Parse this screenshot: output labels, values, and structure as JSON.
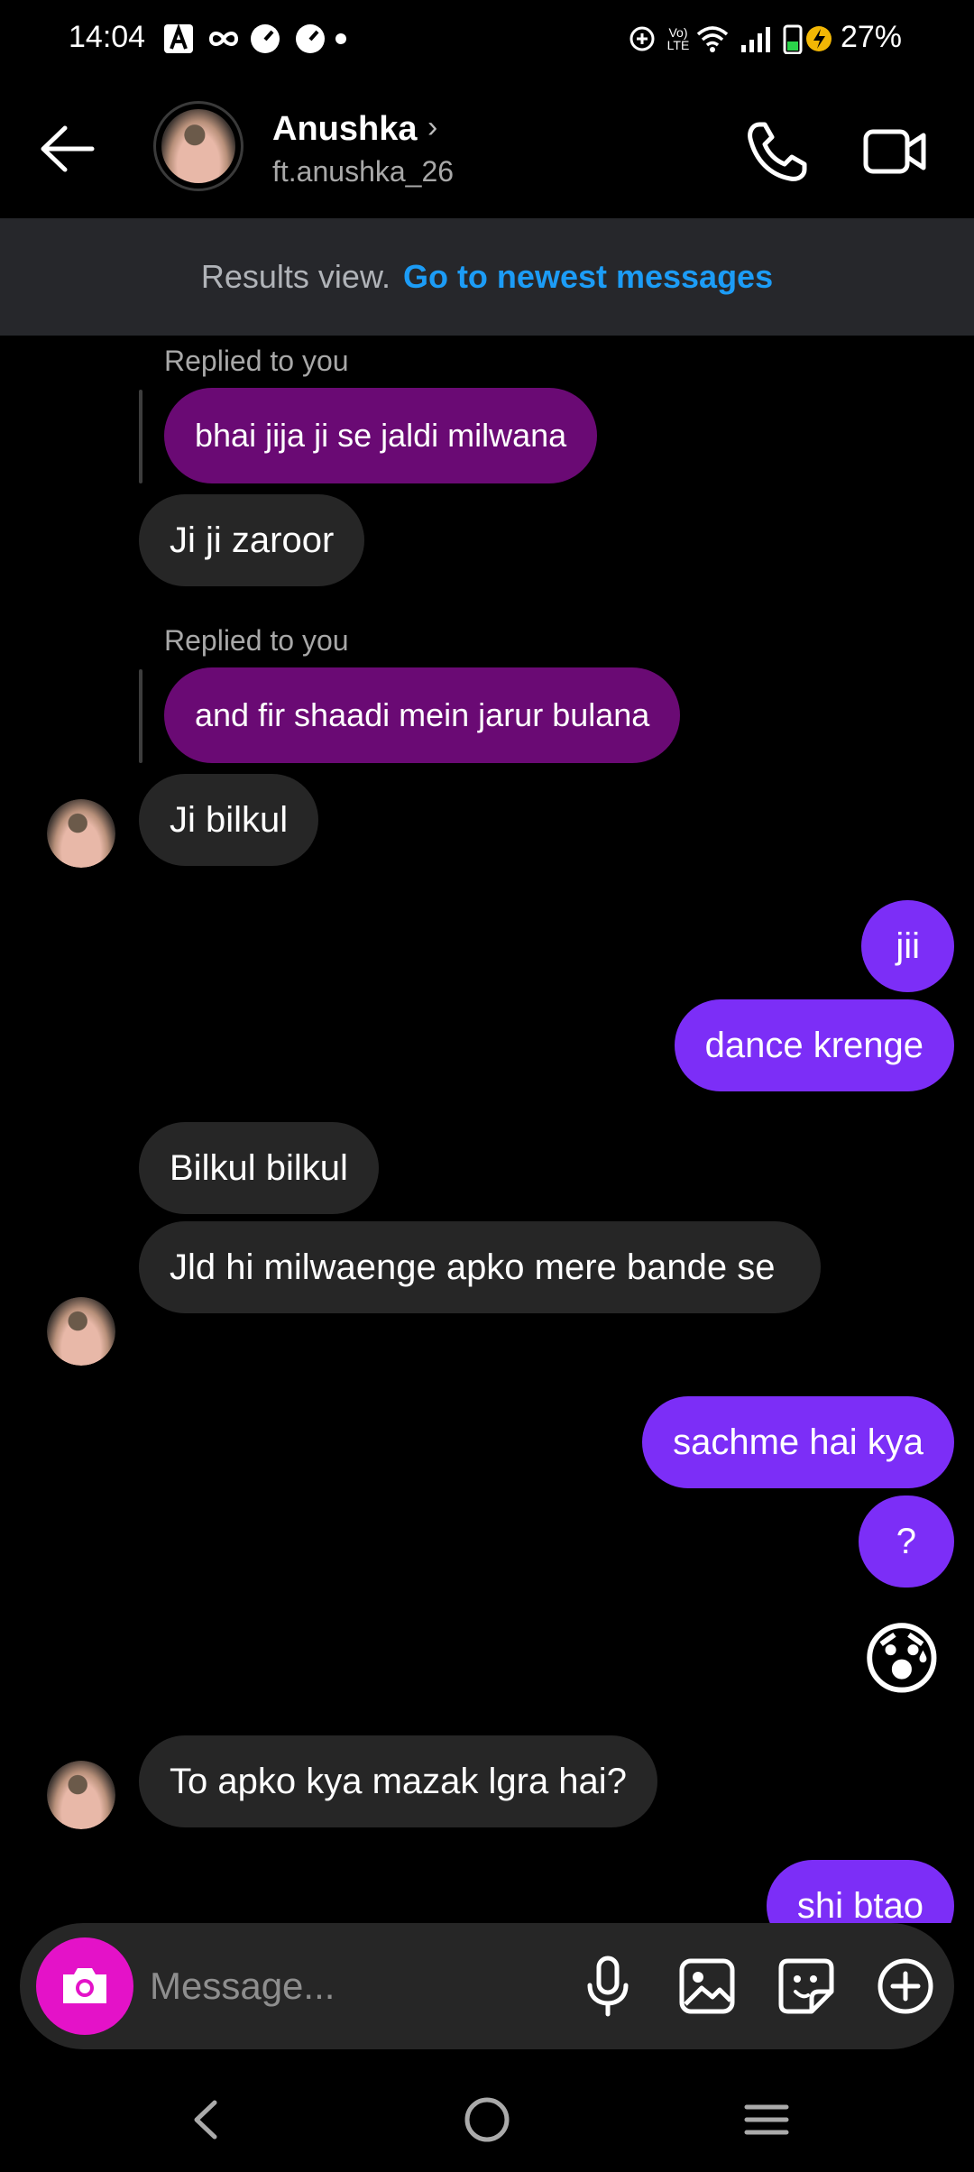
{
  "status_bar": {
    "time": "14:04",
    "battery": "27%",
    "icons": [
      "a-icon",
      "infinity-icon",
      "speed-icon",
      "speed-icon",
      "dot-icon",
      "data-saver-icon",
      "volte-icon",
      "wifi-icon",
      "signal-icon",
      "battery-charging-icon"
    ],
    "volte_text": "Vo)\nLTE"
  },
  "header": {
    "name": "Anushka",
    "handle": "ft.anushka_26",
    "chevron": "›"
  },
  "banner": {
    "text": "Results view.",
    "link": "Go to newest messages"
  },
  "messages": {
    "reply_label": "Replied to you",
    "quoted_1": "bhai jija ji se jaldi milwana",
    "reply_1": "Ji ji zaroor",
    "quoted_2": "and fir shaadi mein jarur bulana",
    "reply_2": "Ji bilkul",
    "out_1": "jii",
    "out_2": "dance krenge",
    "in_1": "Bilkul bilkul",
    "in_2": "Jld hi milwaenge apko mere bande se",
    "out_3": "sachme hai kya",
    "out_4": "?",
    "emoji": "😰",
    "in_3": "To apko kya mazak lgra hai?",
    "out_5": "shi btao"
  },
  "composer": {
    "placeholder": "Message..."
  },
  "colors": {
    "outgoing": "#7c2ef7",
    "incoming": "#262626",
    "quoted": "#6a0a74",
    "link": "#1c9cf6",
    "camera": "#e412c8"
  }
}
